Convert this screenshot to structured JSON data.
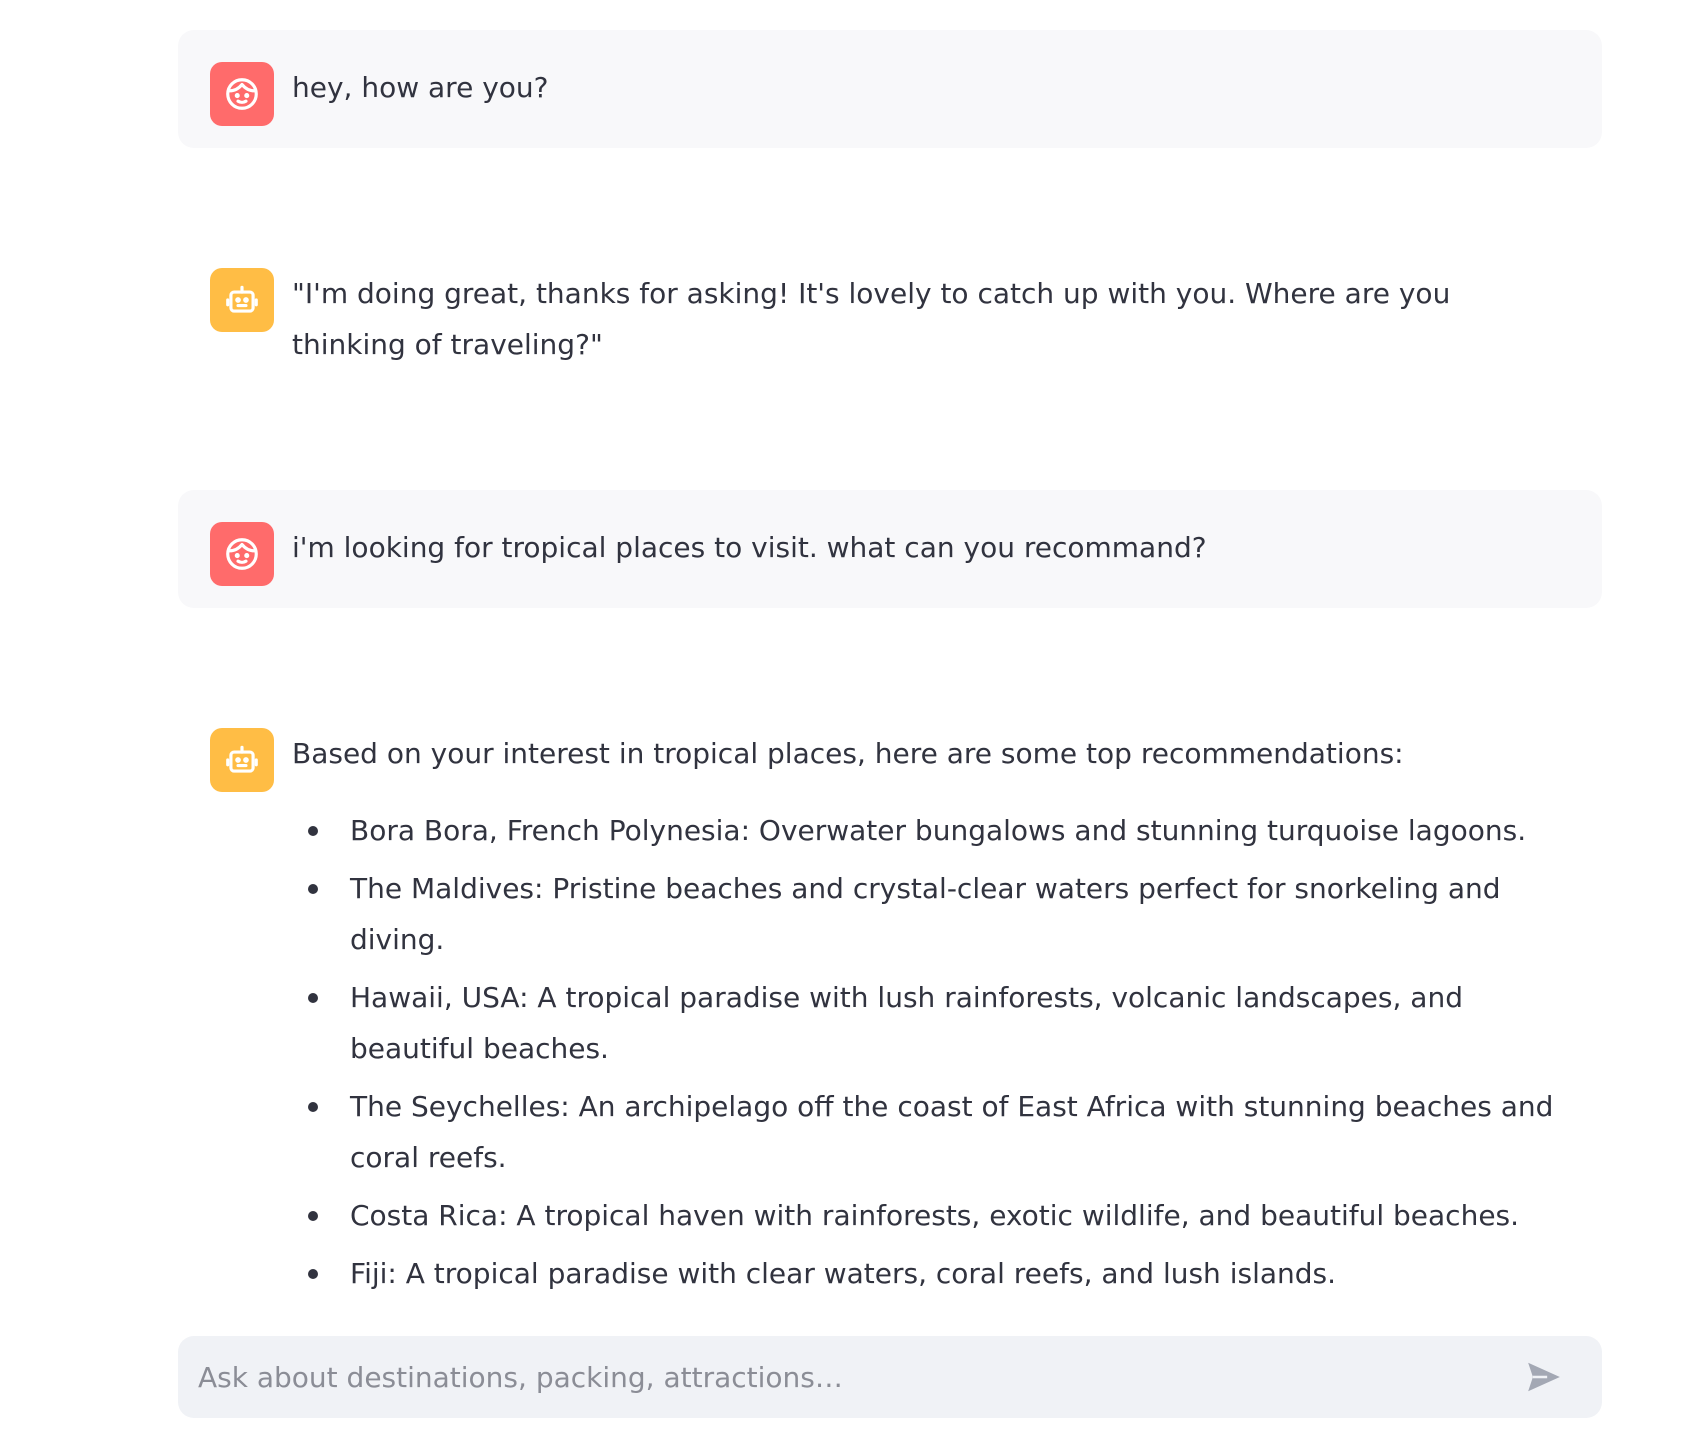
{
  "colors": {
    "user_avatar": "#ff6b6b",
    "assistant_avatar": "#ffbd45",
    "user_bubble": "#f8f8fa",
    "input_bg": "#f0f2f6",
    "text": "#31333f"
  },
  "messages": [
    {
      "role": "user",
      "avatar_icon": "user-face-icon",
      "text": "hey, how are you?"
    },
    {
      "role": "assistant",
      "avatar_icon": "robot-icon",
      "text": "\"I'm doing great, thanks for asking! It's lovely to catch up with you. Where are you thinking of traveling?\""
    },
    {
      "role": "user",
      "avatar_icon": "user-face-icon",
      "text": "i'm looking for tropical places to visit. what can you recommand?"
    },
    {
      "role": "assistant",
      "avatar_icon": "robot-icon",
      "text": "Based on your interest in tropical places, here are some top recommendations:",
      "list": [
        "Bora Bora, French Polynesia: Overwater bungalows and stunning turquoise lagoons.",
        "The Maldives: Pristine beaches and crystal-clear waters perfect for snorkeling and diving.",
        "Hawaii, USA: A tropical paradise with lush rainforests, volcanic landscapes, and beautiful beaches.",
        "The Seychelles: An archipelago off the coast of East Africa with stunning beaches and coral reefs.",
        "Costa Rica: A tropical haven with rainforests, exotic wildlife, and beautiful beaches.",
        "Fiji: A tropical paradise with clear waters, coral reefs, and lush islands."
      ]
    }
  ],
  "chat_input": {
    "placeholder": "Ask about destinations, packing, attractions…",
    "value": "",
    "send_icon": "send-icon"
  }
}
